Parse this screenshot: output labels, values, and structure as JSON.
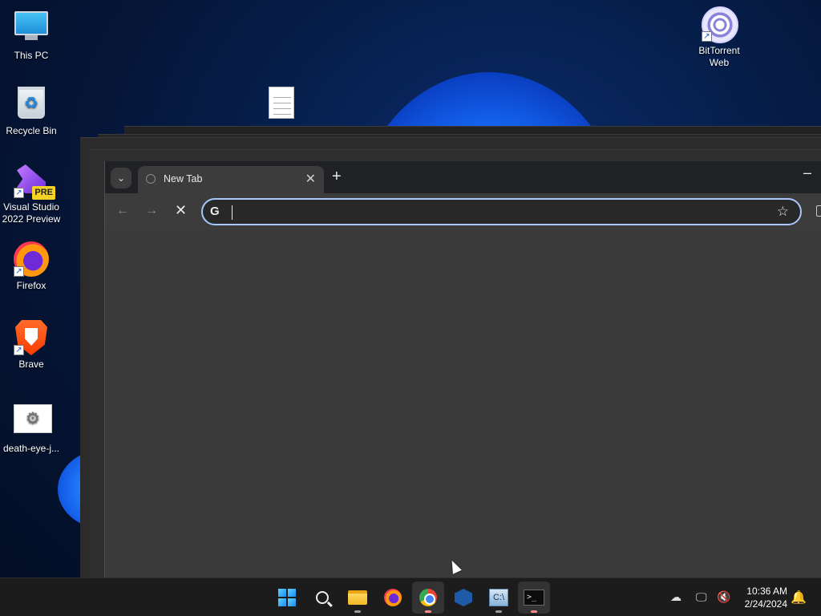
{
  "desktop": {
    "icons": [
      {
        "label": "This PC",
        "icon": "computer-icon"
      },
      {
        "label": "Recycle Bin",
        "icon": "recycle-bin-icon"
      },
      {
        "label": "Visual Studio 2022 Preview",
        "icon": "visual-studio-icon",
        "badge": "PRE"
      },
      {
        "label": "Firefox",
        "icon": "firefox-icon"
      },
      {
        "label": "Brave",
        "icon": "brave-icon"
      },
      {
        "label": "death-eye-j...",
        "icon": "settings-file-icon"
      },
      {
        "label": "BitTorrent Web",
        "icon": "bittorrent-icon"
      }
    ],
    "shortcut_glyph": "↗"
  },
  "browser": {
    "tab_title": "New Tab",
    "tab_close": "✕",
    "new_tab": "+",
    "minimize": "–",
    "tab_search": "⌄",
    "back": "←",
    "forward": "→",
    "stop": "✕",
    "omnibox_value": "",
    "omnibox_g": "G",
    "bookmark": "☆"
  },
  "taskbar": {
    "apps": [
      "start",
      "search",
      "file-explorer",
      "firefox",
      "chrome",
      "virtualbox",
      "tool",
      "terminal"
    ],
    "terminal_glyph": ">_",
    "tool_glyph": "C:\\",
    "time": "10:36 AM",
    "date": "2/24/2024"
  },
  "colors": {
    "accent": "#a8c7fa",
    "taskbar": "#1c1c1c",
    "browser_bg": "#3c3c3c"
  }
}
